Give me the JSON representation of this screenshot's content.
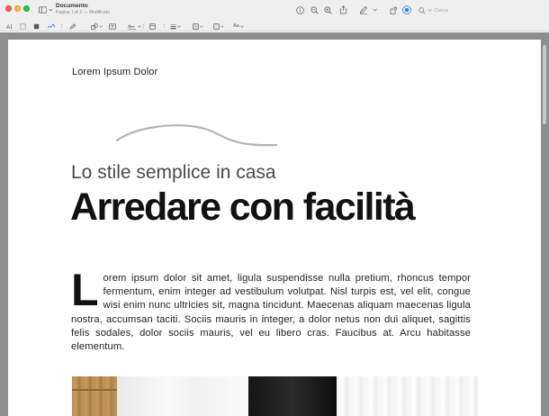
{
  "window": {
    "title": "Documento",
    "subtitle": "Pagina 1 di 2 — Modificato"
  },
  "toolbar": {
    "icons": [
      "info-icon",
      "zoom-out-icon",
      "zoom-in-icon",
      "share-icon",
      "markup-pen-icon",
      "chevron-down-icon",
      "rotate-icon",
      "markup-circle-icon",
      "search-icon"
    ],
    "search_placeholder": "Cerca",
    "accent_color": "#3b82f6"
  },
  "markup_toolbar": {
    "text_style_label": "Aa"
  },
  "document": {
    "kicker": "Lorem Ipsum Dolor",
    "subtitle": "Lo stile semplice in casa",
    "headline": "Arredare con facilità",
    "dropcap": "L",
    "body": "orem ipsum dolor sit amet, ligula suspendisse nulla pretium, rhoncus tempor fermentum, enim integer ad vestibulum volutpat. Nisl turpis est, vel elit, congue wisi enim nunc ultricies sit, magna tincidunt. Maecenas aliquam maecenas ligula nostra, accumsan taciti. Sociis mauris in integer, a dolor netus non dui aliquet, sagittis felis sodales, dolor sociis mauris, vel eu libero cras. Faucibus at. Arcu habitasse elementum."
  },
  "colors": {
    "close": "#ff5f57",
    "minimize": "#febc2e",
    "maximize": "#28c840",
    "scribble": "#b5b5b5",
    "canvas": "#8e8e8e"
  }
}
